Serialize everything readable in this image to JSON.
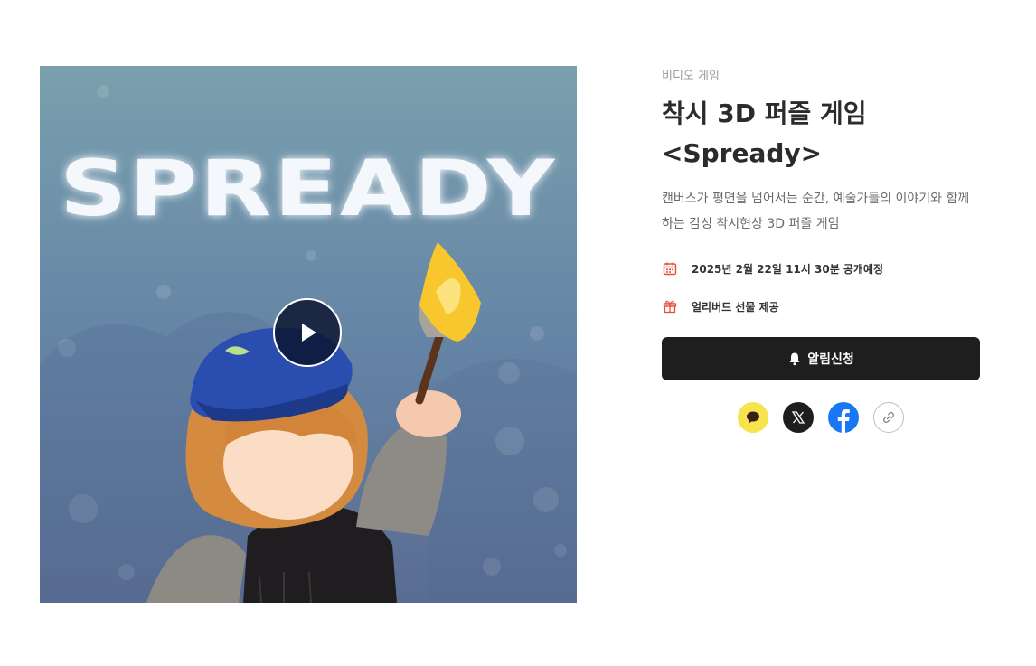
{
  "media": {
    "logo_text": "SPREADY",
    "play_icon": "play-icon"
  },
  "info": {
    "category": "비디오 게임",
    "title_line1": "착시 3D 퍼즐 게임",
    "title_line2": "<Spready>",
    "description": "캔버스가 평면을 넘어서는 순간, 예술가들의 이야기와 함께하는 감성 착시현상 3D 퍼즐 게임",
    "release_text": "2025년 2월 22일 11시 30분 공개예정",
    "release_icon": "calendar-icon",
    "gift_text": "얼리버드 선물 제공",
    "gift_icon": "gift-icon",
    "notify_label": "알림신청",
    "notify_icon": "bell-icon"
  },
  "share": [
    "kakao-icon",
    "x-icon",
    "facebook-icon",
    "link-icon"
  ],
  "colors": {
    "accent_red": "#e5513b",
    "button_dark": "#1e1e1e",
    "kakao_yellow": "#f7e34b",
    "facebook_blue": "#1877f2"
  }
}
